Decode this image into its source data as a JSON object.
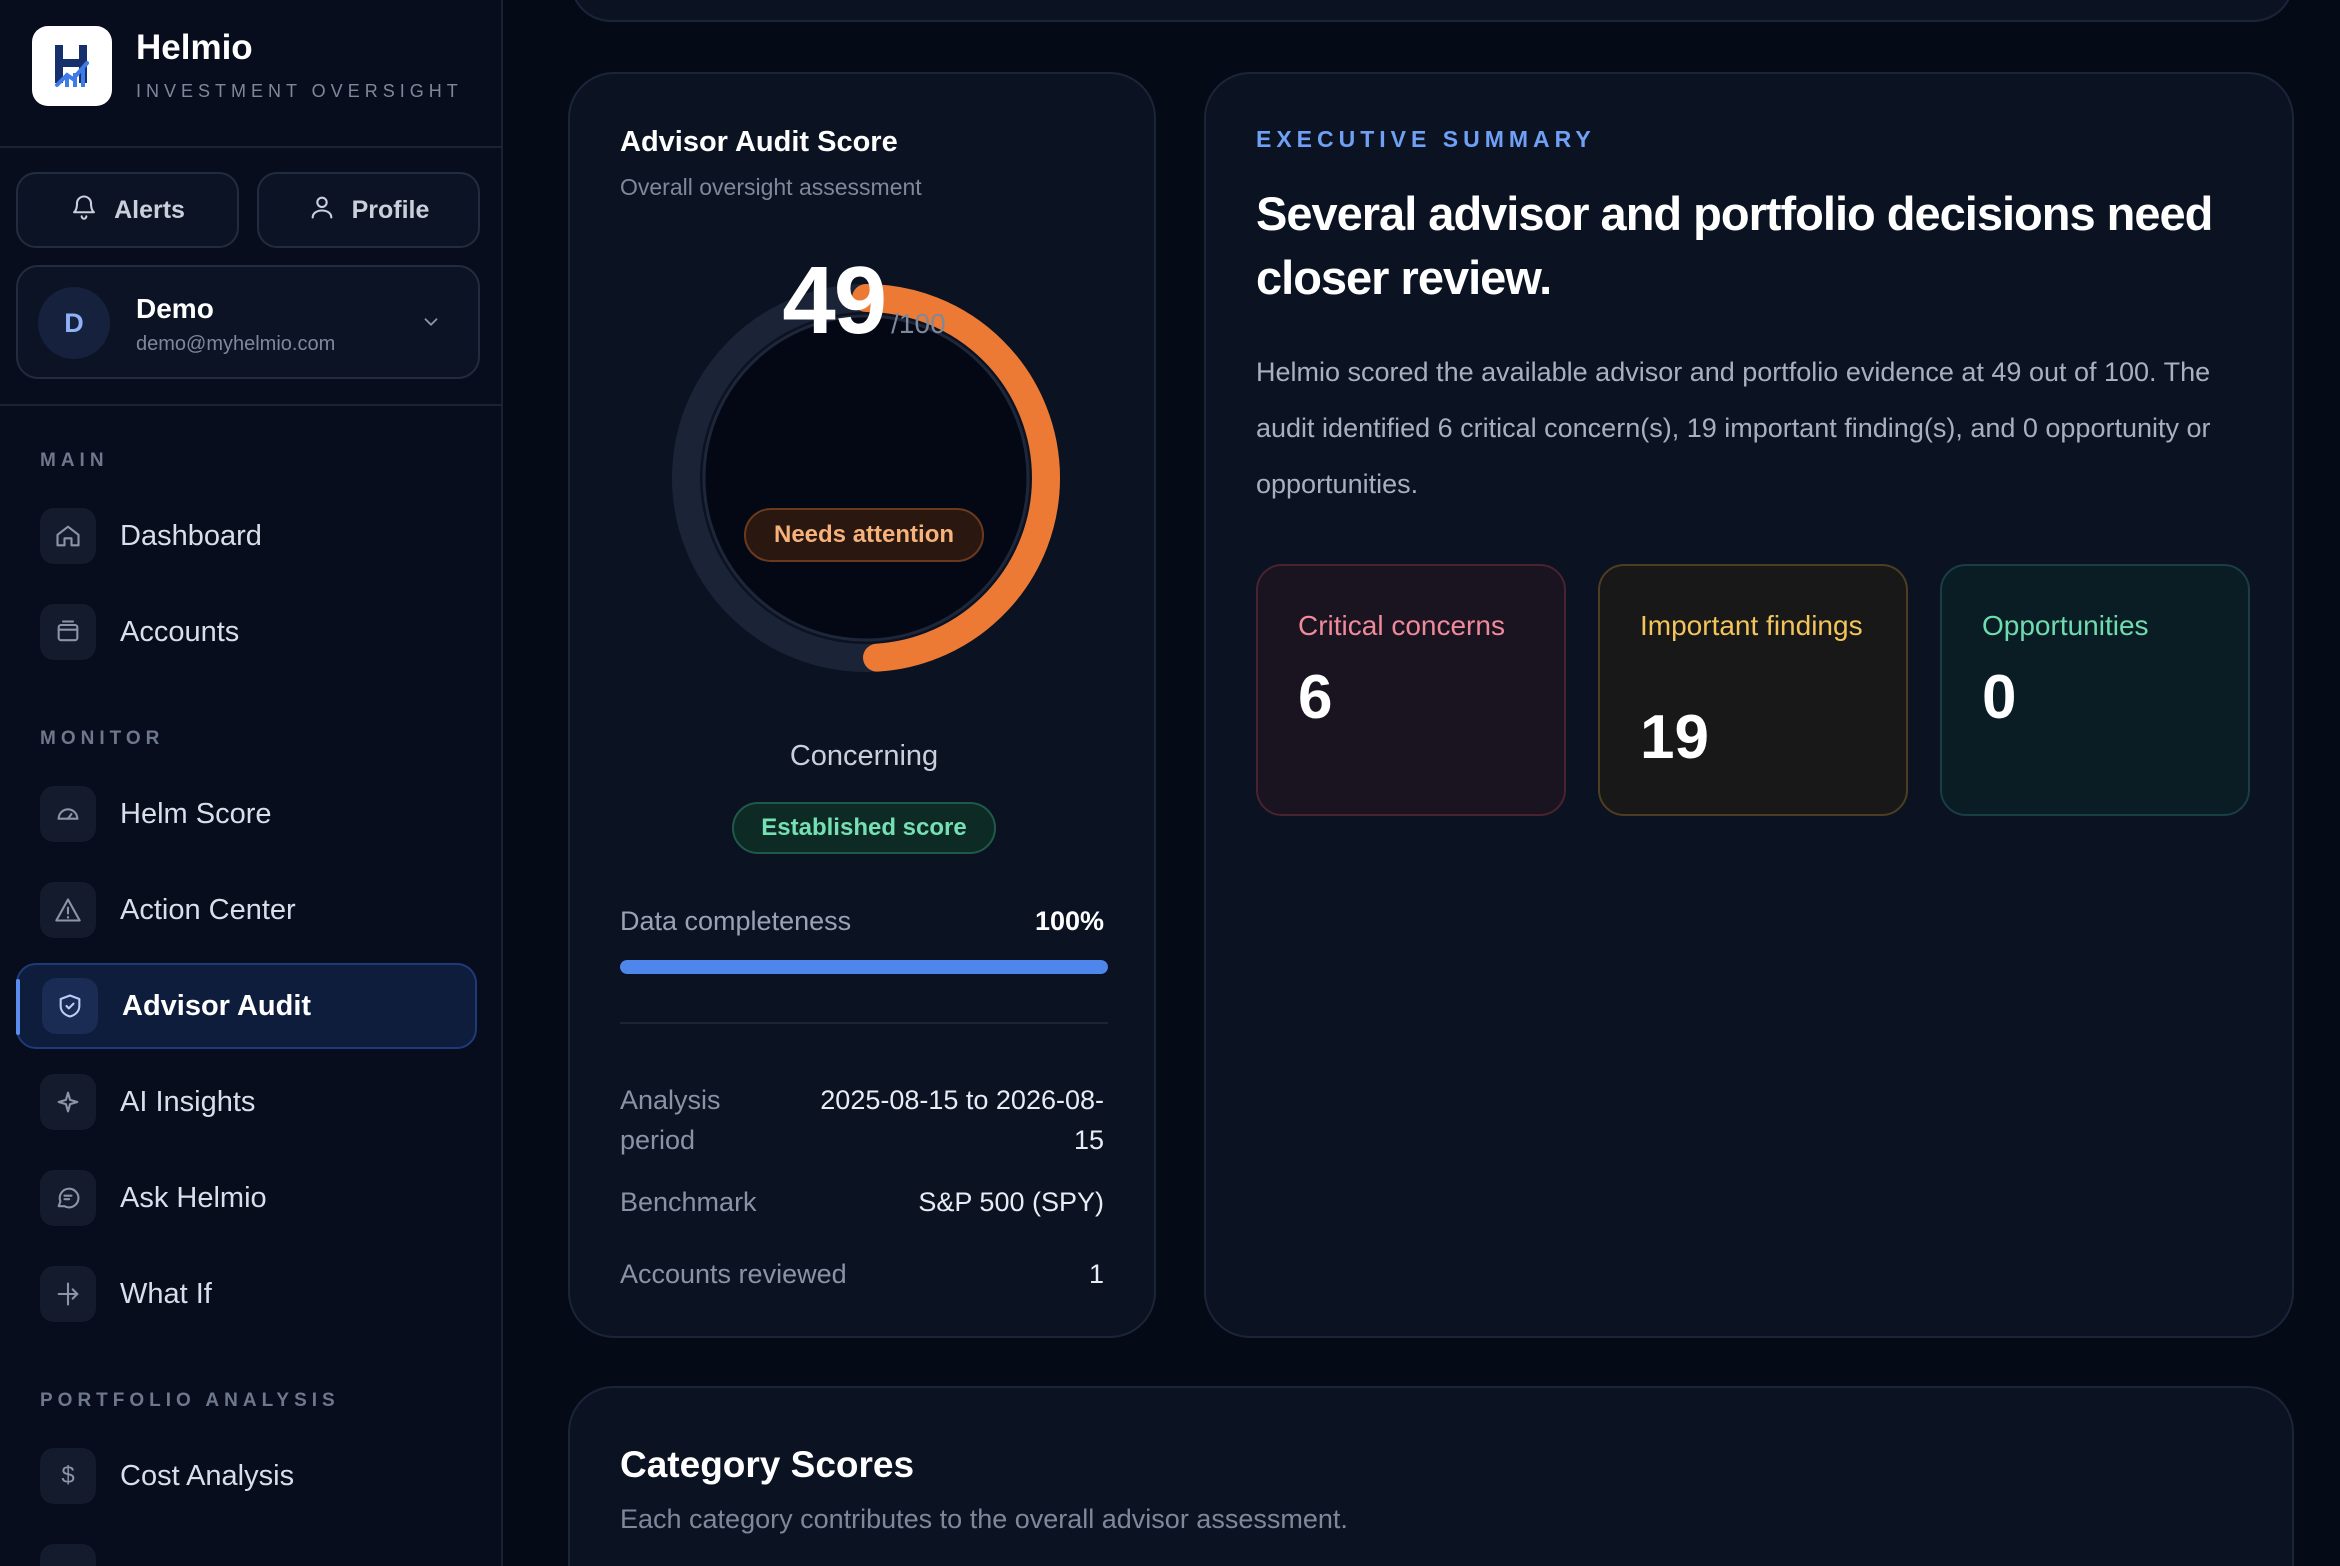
{
  "brand": {
    "name": "Helmio",
    "tagline": "INVESTMENT OVERSIGHT"
  },
  "top_buttons": {
    "alerts": "Alerts",
    "profile": "Profile"
  },
  "user": {
    "initial": "D",
    "name": "Demo",
    "email": "demo@myhelmio.com"
  },
  "sections": {
    "main": "MAIN",
    "monitor": "MONITOR",
    "portfolio": "PORTFOLIO ANALYSIS"
  },
  "nav": {
    "dashboard": "Dashboard",
    "accounts": "Accounts",
    "helm_score": "Helm Score",
    "action_center": "Action Center",
    "advisor_audit": "Advisor Audit",
    "ai_insights": "AI Insights",
    "ask_helmio": "Ask Helmio",
    "what_if": "What If",
    "cost_analysis": "Cost Analysis",
    "cost_analysis_icon": "$"
  },
  "score_card": {
    "title": "Advisor Audit Score",
    "subtitle": "Overall oversight assessment",
    "score": "49",
    "score_max": "/100",
    "score_fraction": 0.49,
    "status_badge": "Needs attention",
    "rating": "Concerning",
    "confidence_badge": "Established score",
    "data_completeness_label": "Data completeness",
    "data_completeness_value": "100%",
    "data_completeness_fraction": 1.0,
    "meta": {
      "period_label": "Analysis period",
      "period_value": "2025-08-15 to 2026-08-15",
      "benchmark_label": "Benchmark",
      "benchmark_value": "S&P 500 (SPY)",
      "accounts_label": "Accounts reviewed",
      "accounts_value": "1"
    }
  },
  "executive_summary": {
    "kicker": "EXECUTIVE SUMMARY",
    "headline": "Several advisor and portfolio decisions need closer review.",
    "body": "Helmio scored the available advisor and portfolio evidence at 49 out of 100. The audit identified 6 critical concern(s), 19 important finding(s), and 0 opportunity or opportunities.",
    "stats": {
      "critical_label": "Critical concerns",
      "critical_value": "6",
      "important_label": "Important findings",
      "important_value": "19",
      "opportunities_label": "Opportunities",
      "opportunities_value": "0"
    }
  },
  "category_scores": {
    "title": "Category Scores",
    "subtitle": "Each category contributes to the overall advisor assessment."
  },
  "colors": {
    "accent": "#4f86ec",
    "score_arc": "#ec7a35",
    "critical": "#f08a9a",
    "important": "#f2c45a",
    "opportunity": "#6fdcb0"
  }
}
